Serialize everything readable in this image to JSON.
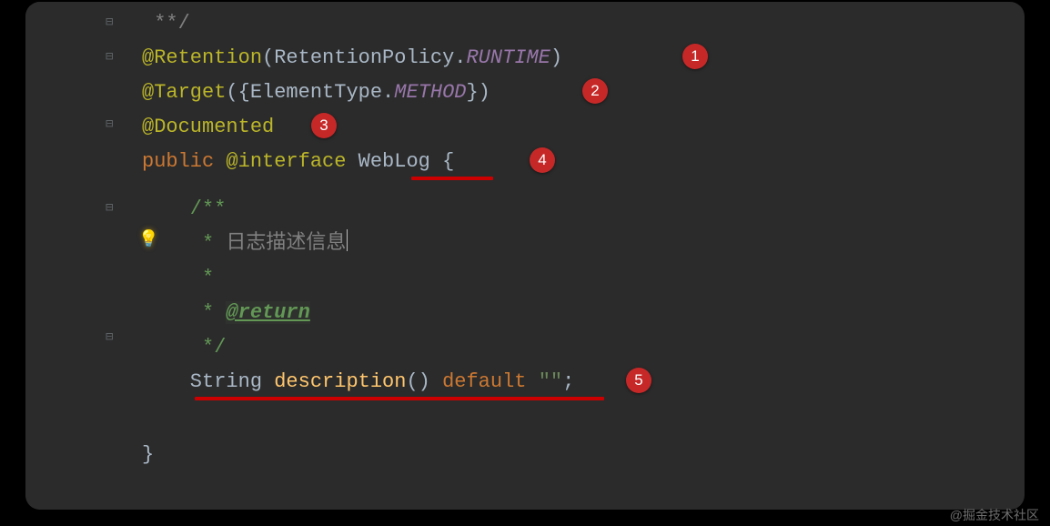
{
  "lines": {
    "l0": " **/",
    "l1a": "@Retention",
    "l1b": "(RetentionPolicy.",
    "l1c": "RUNTIME",
    "l1d": ")",
    "l2a": "@Target",
    "l2b": "({ElementType.",
    "l2c": "METHOD",
    "l2d": "})",
    "l3": "@Documented",
    "l4a": "public ",
    "l4b": "@interface ",
    "l4c": "WebLog ",
    "l4d": "{",
    "l5": "    /**",
    "l6a": "     * ",
    "l6b": "日志描述信息",
    "l7": "     *",
    "l8a": "     * ",
    "l8b": "@return",
    "l9": "     */",
    "l10a": "    String ",
    "l10b": "description",
    "l10c": "() ",
    "l10d": "default ",
    "l10e": "\"\"",
    "l10f": ";",
    "l12": "}"
  },
  "badges": {
    "b1": "1",
    "b2": "2",
    "b3": "3",
    "b4": "4",
    "b5": "5"
  },
  "watermark": "@掘金技术社区",
  "icons": {
    "bulb": "💡"
  }
}
